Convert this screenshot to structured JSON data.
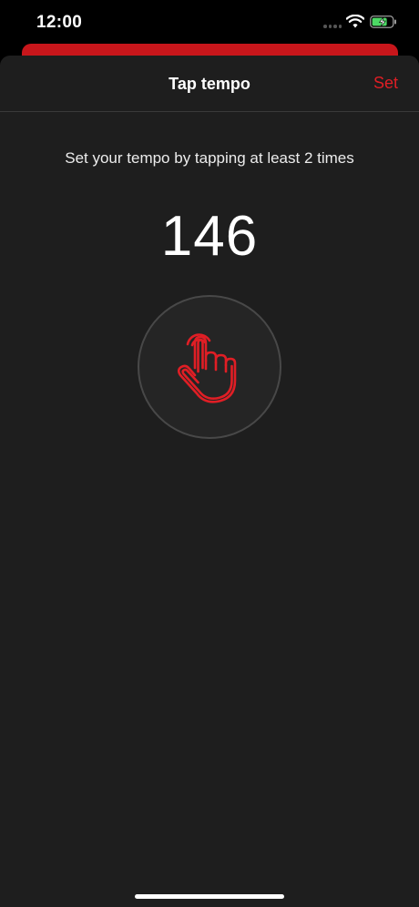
{
  "status_bar": {
    "time": "12:00",
    "icons": [
      "signal-dots-icon",
      "wifi-icon",
      "battery-charging-icon"
    ]
  },
  "sheet": {
    "title": "Tap tempo",
    "action_label": "Set",
    "instruction": "Set your tempo by tapping at least 2 times",
    "tempo": "146",
    "tap_icon": "tap-hand-icon"
  },
  "colors": {
    "accent": "#e01e25",
    "sheet_background": "#1e1e1e",
    "underlay_card": "#c8161b",
    "battery_fill": "#4cd964"
  }
}
